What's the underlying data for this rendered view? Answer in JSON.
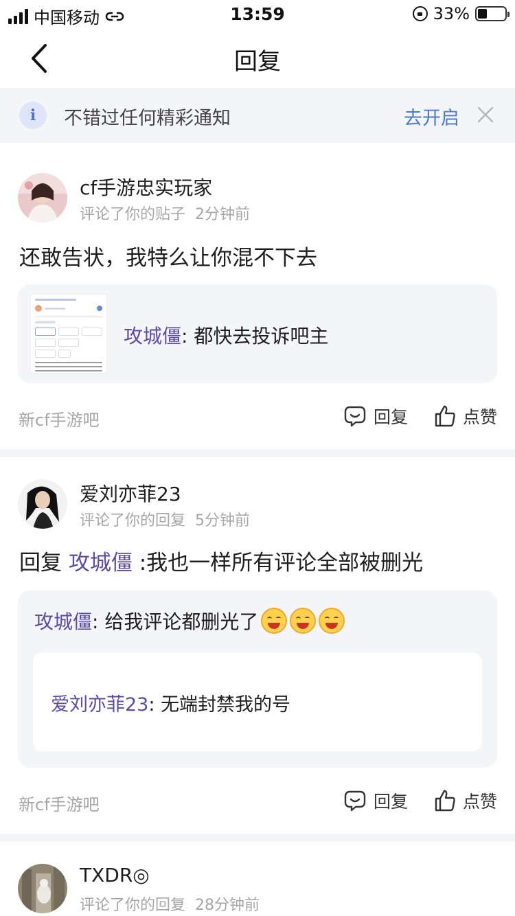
{
  "status_bar": {
    "carrier": "中国移动",
    "time": "13:59",
    "battery_percent": "33%",
    "battery_level": 0.33
  },
  "nav": {
    "title": "回复"
  },
  "notice": {
    "icon_text": "i",
    "text": "不错过任何精彩通知",
    "action": "去开启"
  },
  "items": [
    {
      "username": "cf手游忠实玩家",
      "meta_action": "评论了你的贴子",
      "time": "2分钟前",
      "content": "还敢告状，我特么让你混不下去",
      "quote": {
        "author": "攻城僵",
        "text": ": 都快去投诉吧主"
      },
      "forum": "新cf手游吧",
      "reply_label": "回复",
      "like_label": "点赞"
    },
    {
      "username": "爱刘亦菲23",
      "meta_action": "评论了你的回复",
      "time": "5分钟前",
      "content_prefix": "回复 ",
      "content_mention": "攻城僵",
      "content_rest": " :我也一样所有评论全部被删光",
      "quote": {
        "author": "攻城僵",
        "text": ": 给我评论都删光了"
      },
      "nested": {
        "author": "爱刘亦菲23",
        "text": ": 无端封禁我的号"
      },
      "forum": "新cf手游吧",
      "reply_label": "回复",
      "like_label": "点赞"
    },
    {
      "username": "TXDR◎",
      "meta_action": "评论了你的回复",
      "time": "28分钟前"
    }
  ],
  "icons": {
    "back": "chevron-left-icon",
    "info": "info-icon",
    "close": "close-icon",
    "reply": "comment-bubble-icon",
    "like": "thumbs-up-icon",
    "emoji": "grinning-emoji-icon"
  },
  "colors": {
    "accent_blue": "#4a78d6",
    "mention_purple": "#5b4aa8",
    "muted": "#a6a6a6",
    "panel_bg": "#f4f5f8"
  }
}
